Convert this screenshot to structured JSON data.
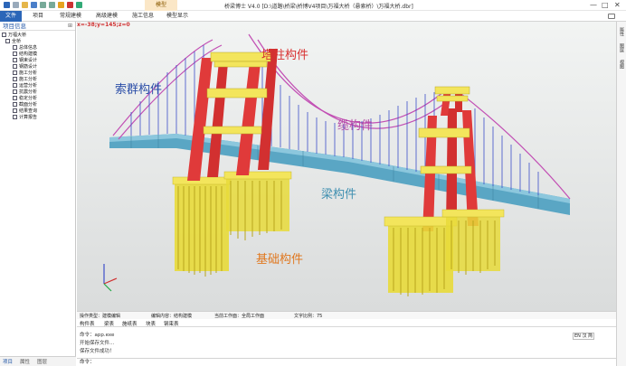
{
  "window": {
    "title": "桥梁博士 V4.0   [D:\\道路\\桥梁\\桥博V4项目\\万福大桥（悬索桥）\\万福大桥.dbr]",
    "context_tab": "模型",
    "minimize": "—",
    "maximize": "□",
    "close": "✕"
  },
  "ribbon": {
    "tabs": [
      "文件",
      "项目",
      "常规建模",
      "高级建模",
      "施工信息",
      "模型显示"
    ]
  },
  "left_panel": {
    "title": "项目信息",
    "pin": "⊞",
    "tree": [
      {
        "label": "万福大桥",
        "level": 0
      },
      {
        "label": "全桥",
        "level": 1
      },
      {
        "label": "总体信息",
        "level": 2
      },
      {
        "label": "结构建模",
        "level": 2
      },
      {
        "label": "钢束设计",
        "level": 2
      },
      {
        "label": "钢筋设计",
        "level": 2
      },
      {
        "label": "施工分析",
        "level": 2
      },
      {
        "label": "施工分析",
        "level": 2
      },
      {
        "label": "运营分析",
        "level": 2
      },
      {
        "label": "抗震分析",
        "level": 2
      },
      {
        "label": "稳定分析",
        "level": 2
      },
      {
        "label": "截面分析",
        "level": 2
      },
      {
        "label": "结果查询",
        "level": 2
      },
      {
        "label": "计算报告",
        "level": 2
      }
    ],
    "bottom_tabs": [
      "项目",
      "属性",
      "图层"
    ]
  },
  "viewport": {
    "coords": "x=-38;y=145;z=0",
    "labels": {
      "tower": "塔柱构件",
      "cable_group": "索群构件",
      "cable": "缆构件",
      "girder": "梁构件",
      "foundation": "基础构件"
    },
    "colors": {
      "tower": "#e03a3a",
      "beam": "#f3e55c",
      "deck": "#5aa6c4",
      "cable": "#c24fb4",
      "hanger": "#3d4ec9",
      "pile": "#e8da3a"
    }
  },
  "view_bar": {
    "items": [
      "操作类型：建模编辑",
      "编辑内容：结构建模",
      "当前工作面：全局工作面",
      "文字比例：75"
    ]
  },
  "sub_tabs": [
    "构件表",
    "梁表",
    "施纸表",
    "块表",
    "钢束表"
  ],
  "command": {
    "lines": [
      "命令：app.exe",
      "开始保存文件...",
      "保存文件成功！"
    ],
    "prompt": "命令：",
    "lang": "EN 汉 简"
  },
  "right_strip": [
    "属性",
    "图层",
    "视图"
  ]
}
